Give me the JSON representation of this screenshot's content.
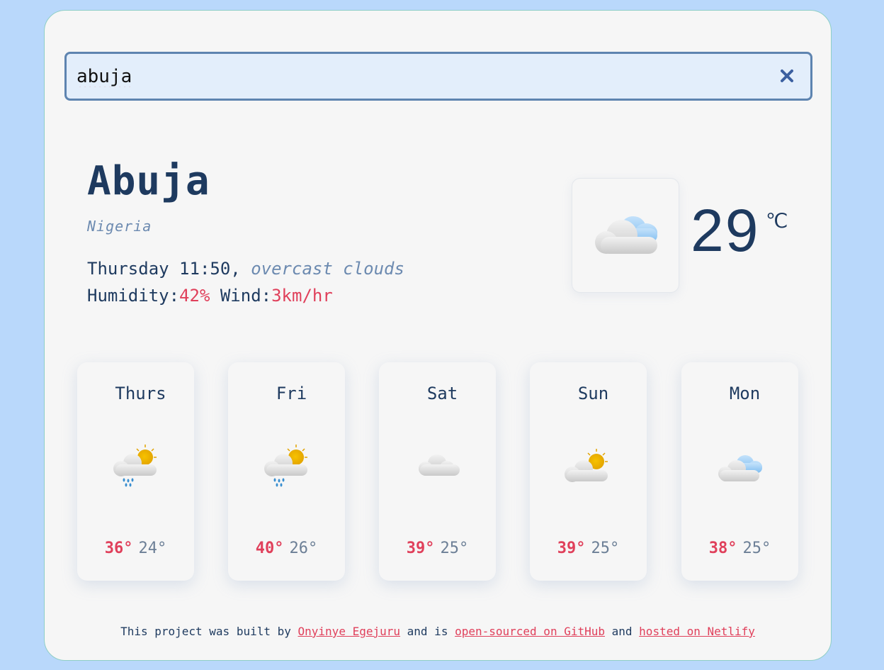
{
  "search": {
    "value": "abuja"
  },
  "current": {
    "city": "Abuja",
    "country": "Nigeria",
    "day_time": "Thursday 11:50,",
    "description": "overcast clouds",
    "humidity_label": "Humidity:",
    "humidity_value": "42%",
    "wind_label": "Wind:",
    "wind_value": "3km/hr",
    "temperature": "29",
    "unit": "℃",
    "icon": "overcast-clouds-icon"
  },
  "forecast": [
    {
      "day": "Thurs",
      "max": "36°",
      "min": "24°",
      "icon": "sun-cloud-rain-icon"
    },
    {
      "day": "Fri",
      "max": "40°",
      "min": "26°",
      "icon": "sun-cloud-rain-icon"
    },
    {
      "day": "Sat",
      "max": "39°",
      "min": "25°",
      "icon": "cloud-icon"
    },
    {
      "day": "Sun",
      "max": "39°",
      "min": "25°",
      "icon": "sun-cloud-icon"
    },
    {
      "day": "Mon",
      "max": "38°",
      "min": "25°",
      "icon": "blue-cloud-icon"
    }
  ],
  "footer": {
    "text1": "This project was built by ",
    "author": "Onyinye Egejuru",
    "text2": " and is ",
    "github": "open-sourced on GitHub",
    "text3": " and ",
    "netlify": "hosted on Netlify"
  },
  "colors": {
    "accent": "#e0405b",
    "primary": "#1e3a5f",
    "muted": "#6c8ab0",
    "background": "#b9d8fb"
  }
}
